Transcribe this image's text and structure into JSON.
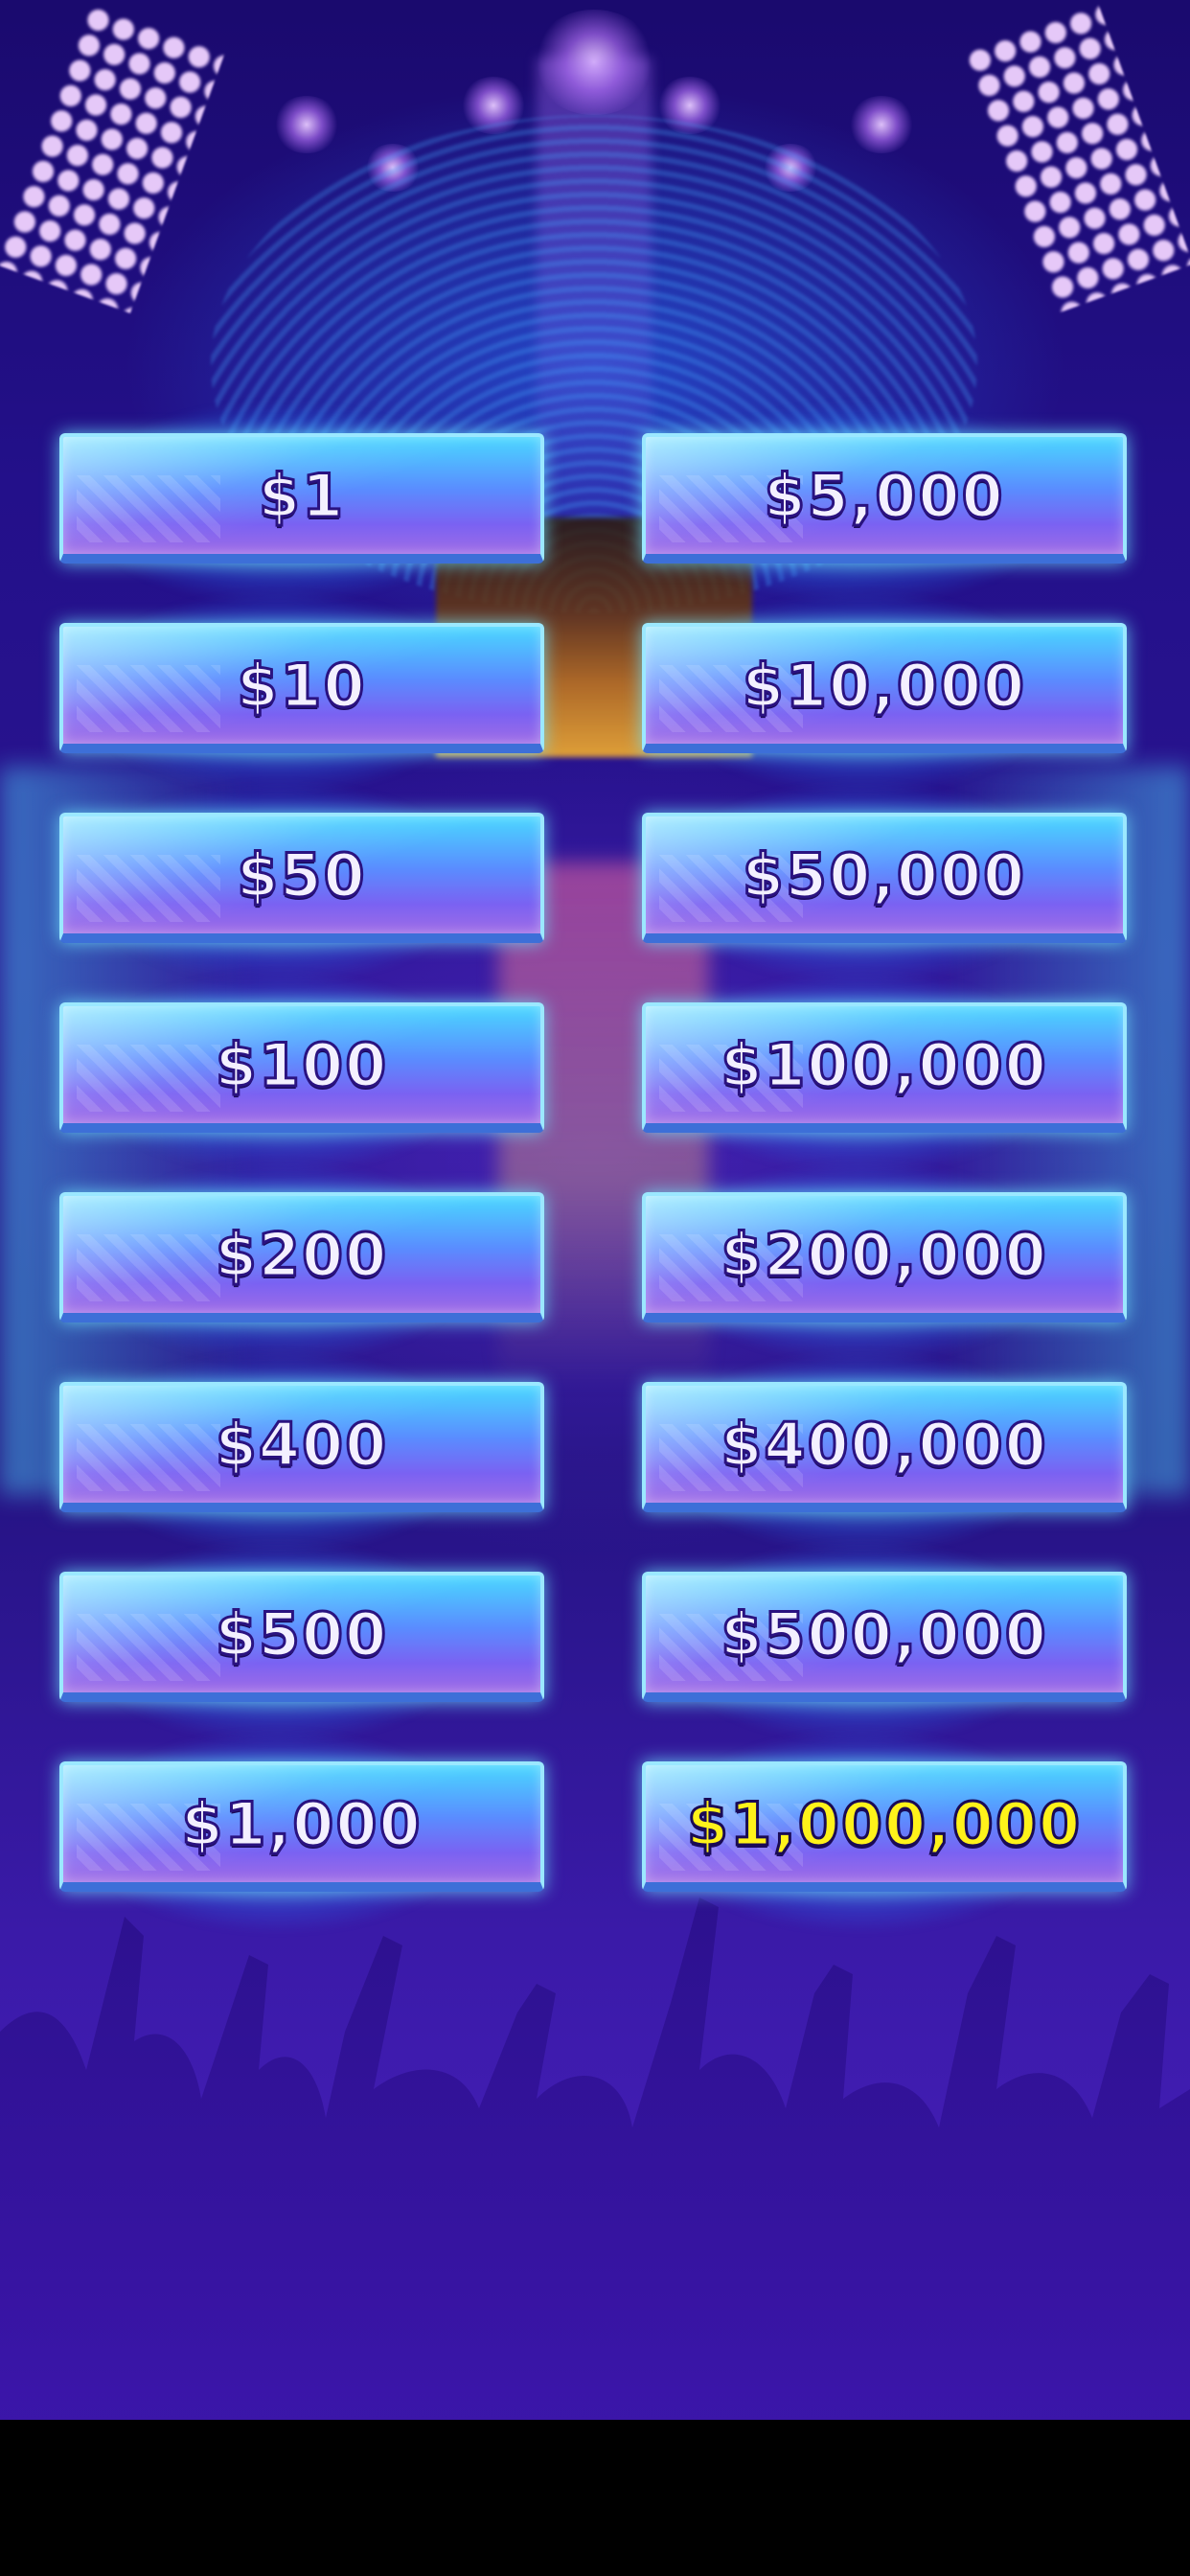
{
  "board": {
    "left_column": [
      {
        "label": "$1"
      },
      {
        "label": "$10"
      },
      {
        "label": "$50"
      },
      {
        "label": "$100"
      },
      {
        "label": "$200"
      },
      {
        "label": "$400"
      },
      {
        "label": "$500"
      },
      {
        "label": "$1,000"
      }
    ],
    "right_column": [
      {
        "label": "$5,000"
      },
      {
        "label": "$10,000"
      },
      {
        "label": "$50,000"
      },
      {
        "label": "$100,000"
      },
      {
        "label": "$200,000"
      },
      {
        "label": "$400,000"
      },
      {
        "label": "$500,000"
      },
      {
        "label": "$1,000,000",
        "highlight": true
      }
    ]
  },
  "colors": {
    "label_text": "#f3f0ff",
    "jackpot_text": "#fff21a",
    "button_top": "#4ad7ff",
    "button_bottom": "#a06ce6",
    "background": "#2a1490"
  }
}
